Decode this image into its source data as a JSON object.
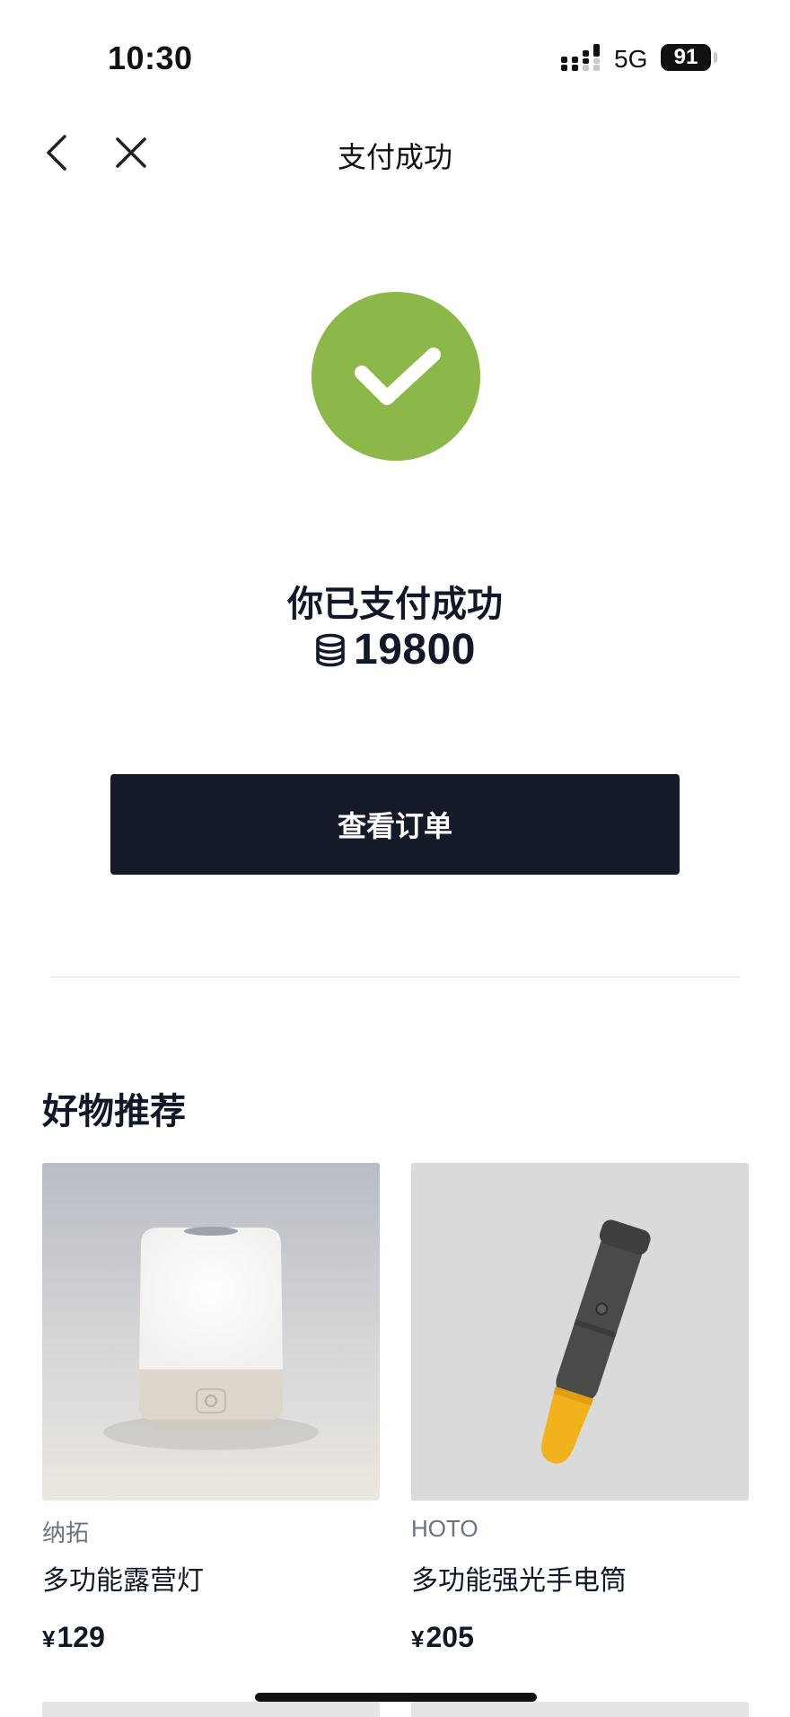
{
  "status_bar": {
    "time": "10:30",
    "network": "5G",
    "battery": "91"
  },
  "nav": {
    "title": "支付成功",
    "back_icon": "chevron-left-icon",
    "close_icon": "close-icon"
  },
  "result": {
    "message": "你已支付成功",
    "amount": "19800",
    "amount_icon": "coin-stack-icon",
    "status_color": "#8bb848"
  },
  "actions": {
    "view_order_label": "查看订单"
  },
  "recommendations": {
    "title": "好物推荐",
    "items": [
      {
        "brand": "纳拓",
        "name": "多功能露营灯",
        "currency": "¥",
        "price": "129",
        "image": "camping-lantern-image"
      },
      {
        "brand": "HOTO",
        "name": "多功能强光手电筒",
        "currency": "¥",
        "price": "205",
        "image": "flashlight-image"
      }
    ]
  },
  "colors": {
    "accent": "#8bb848",
    "button_bg": "#141a28",
    "text_primary": "#111827",
    "text_secondary": "#6b7280"
  }
}
